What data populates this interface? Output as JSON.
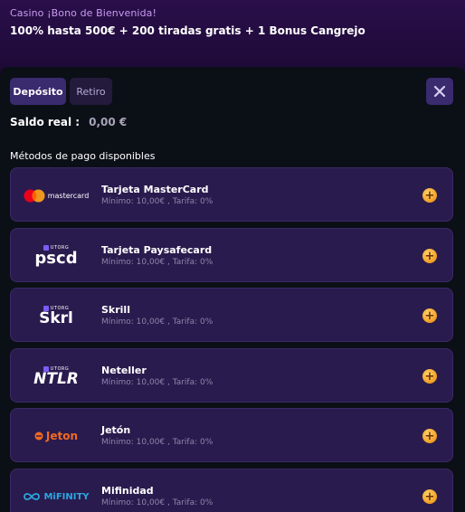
{
  "banner": {
    "subtitle": "Casino ¡Bono de Bienvenida!",
    "title": "100% hasta 500€ + 200 tiradas gratis + 1 Bonus Cangrejo"
  },
  "tabs": [
    {
      "label": "Depósito",
      "active": true
    },
    {
      "label": "Retiro",
      "active": false
    }
  ],
  "balance": {
    "label": "Saldo real :",
    "value": "0,00 €"
  },
  "methods_title": "Métodos de pago disponibles",
  "methods": [
    {
      "name": "Tarjeta MasterCard",
      "fee": "Mínimo: 10,00€ , Tarifa: 0%",
      "logo": "mastercard-logo",
      "logo_text": "mastercard"
    },
    {
      "name": "Tarjeta Paysafecard",
      "fee": "Mínimo: 10,00€ , Tarifa: 0%",
      "logo": "paysafecard-logo",
      "logo_text": "pscd",
      "badge_text": "UTORG"
    },
    {
      "name": "Skrill",
      "fee": "Mínimo: 10,00€ , Tarifa: 0%",
      "logo": "skrill-logo",
      "logo_text": "Skrl",
      "badge_text": "UTORG"
    },
    {
      "name": "Neteller",
      "fee": "Mínimo: 10,00€ , Tarifa: 0%",
      "logo": "neteller-logo",
      "logo_text": "NTLR",
      "badge_text": "UTORG"
    },
    {
      "name": "Jetón",
      "fee": "Mínimo: 10,00€ , Tarifa: 0%",
      "logo": "jeton-logo",
      "logo_text": "Jeton"
    },
    {
      "name": "Mifinidad",
      "fee": "Mínimo: 10,00€ , Tarifa: 0%",
      "logo": "mifinity-logo",
      "logo_text": "MiFINITY"
    }
  ],
  "colors": {
    "accent": "#3a2a6e",
    "card": "#2a1b4e",
    "add": "#f3a52b",
    "jeton": "#f26a21",
    "mifinity": "#2aa7e0"
  }
}
